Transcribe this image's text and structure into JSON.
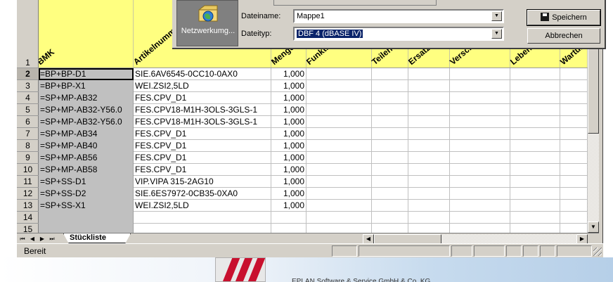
{
  "dialog": {
    "network_label": "Netzwerkumg...",
    "filename_label": "Dateiname:",
    "filename_value": "Mappe1",
    "filetype_label": "Dateityp:",
    "filetype_value": "DBF 4 (dBASE IV)",
    "save_button": "Speichern",
    "cancel_button": "Abbrechen"
  },
  "sheet": {
    "columns": [
      {
        "label": "BMK"
      },
      {
        "label": "Artikelnummer"
      },
      {
        "label": "Menge"
      },
      {
        "label": "Funktion"
      },
      {
        "label": "Teilenummer"
      },
      {
        "label": "Ersatzteil"
      },
      {
        "label": "Verschleiß"
      },
      {
        "label": "Lebensdauer"
      },
      {
        "label": "Wartung"
      }
    ],
    "header_row_number": "1",
    "rows": [
      {
        "n": "2",
        "bmk": "=BP+BP-D1",
        "art": "SIE.6AV6545-0CC10-0AX0",
        "qty": "1,000"
      },
      {
        "n": "3",
        "bmk": "=BP+BP-X1",
        "art": "WEI.ZSI2,5LD",
        "qty": "1,000"
      },
      {
        "n": "4",
        "bmk": "=SP+MP-AB32",
        "art": "FES.CPV_D1",
        "qty": "1,000"
      },
      {
        "n": "5",
        "bmk": "=SP+MP-AB32-Y56.0",
        "art": "FES.CPV18-M1H-3OLS-3GLS-1",
        "qty": "1,000"
      },
      {
        "n": "6",
        "bmk": "=SP+MP-AB32-Y56.0",
        "art": "FES.CPV18-M1H-3OLS-3GLS-1",
        "qty": "1,000"
      },
      {
        "n": "7",
        "bmk": "=SP+MP-AB34",
        "art": "FES.CPV_D1",
        "qty": "1,000"
      },
      {
        "n": "8",
        "bmk": "=SP+MP-AB40",
        "art": "FES.CPV_D1",
        "qty": "1,000"
      },
      {
        "n": "9",
        "bmk": "=SP+MP-AB56",
        "art": "FES.CPV_D1",
        "qty": "1,000"
      },
      {
        "n": "10",
        "bmk": "=SP+MP-AB58",
        "art": "FES.CPV_D1",
        "qty": "1,000"
      },
      {
        "n": "11",
        "bmk": "=SP+SS-D1",
        "art": "VIP.VIPA 315-2AG10",
        "qty": "1,000"
      },
      {
        "n": "12",
        "bmk": "=SP+SS-D2",
        "art": "SIE.6ES7972-0CB35-0XA0",
        "qty": "1,000"
      },
      {
        "n": "13",
        "bmk": "=SP+SS-X1",
        "art": "WEI.ZSI2,5LD",
        "qty": "1,000"
      },
      {
        "n": "14",
        "bmk": "",
        "art": "",
        "qty": ""
      },
      {
        "n": "15",
        "bmk": "",
        "art": "",
        "qty": ""
      }
    ],
    "tab_label": "Stückliste"
  },
  "status": {
    "text": "Bereit"
  },
  "desktop": {
    "footer_text": "EPLAN Software & Service GmbH & Co. KG"
  },
  "colors": {
    "header_yellow": "#ffff80",
    "bmk_gray": "#c0c0c0",
    "selection_blue": "#0a246a",
    "brand_red": "#c8102e"
  }
}
